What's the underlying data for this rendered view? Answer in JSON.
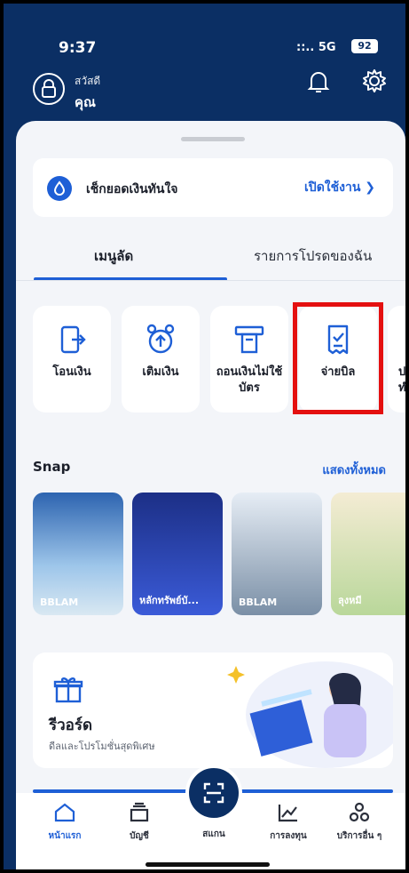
{
  "status_bar": {
    "time": "9:37",
    "signal": "5G",
    "battery": "92"
  },
  "header": {
    "greeting": "สวัสดี",
    "name": "คุณ"
  },
  "balance_check": {
    "title": "เช็กยอดเงินทันใจ",
    "action": "เปิดใช้งาน ❯"
  },
  "tabs": [
    {
      "label": "เมนูลัด"
    },
    {
      "label": "รายการโปรดของฉัน"
    }
  ],
  "menu": [
    {
      "label": "โอนเงิน",
      "icon": "transfer-icon"
    },
    {
      "label": "เติมเงิน",
      "icon": "topup-icon"
    },
    {
      "label": "ถอนเงินไม่ใช้บัตร",
      "icon": "cardless-withdraw-icon"
    },
    {
      "label": "จ่ายบิล",
      "icon": "bill-pay-icon"
    },
    {
      "label": "ปร ทำ",
      "icon": "partial-icon"
    }
  ],
  "snap": {
    "title": "Snap",
    "see_all": "แสดงทั้งหมด",
    "cards": [
      {
        "label": "BBLAM",
        "color": "#5e8fc4"
      },
      {
        "label": "หลักทรัพย์บั...",
        "color": "#1c2f86"
      },
      {
        "label": "BBLAM",
        "color": "#7a8fa6"
      },
      {
        "label": "ลุงหมี",
        "color": "#f0e7cf"
      }
    ]
  },
  "reward": {
    "title": "รีวอร์ด",
    "subtitle": "ดีลและโปรโมชั่นสุดพิเศษ"
  },
  "nav": [
    {
      "label": "หน้าแรก",
      "icon": "home-icon"
    },
    {
      "label": "บัญชี",
      "icon": "wallet-icon"
    },
    {
      "label": "สแกน",
      "icon": "scan-icon"
    },
    {
      "label": "การลงทุน",
      "icon": "chart-icon"
    },
    {
      "label": "บริการอื่น ๆ",
      "icon": "services-icon"
    }
  ],
  "colors": {
    "brand": "#0b2f64",
    "accent": "#1e5fd6",
    "highlight": "#e41010"
  }
}
